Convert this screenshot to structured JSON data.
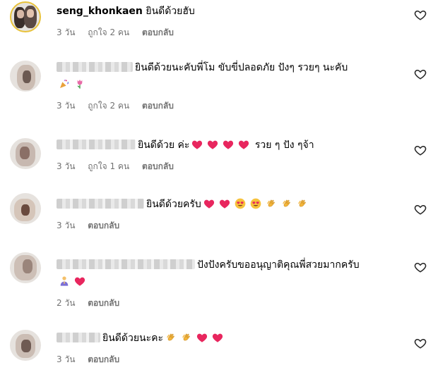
{
  "comments": [
    {
      "username": "seng_khonkaen",
      "text": "ยินดีด้วยฮับ",
      "time": "3 วัน",
      "likes": "ถูกใจ 2 คน",
      "reply": "ตอบกลับ"
    },
    {
      "text": "ยินดีด้วยนะคับพี่โม ขับขี่ปลอดภัย ปังๆ รวยๆ นะคับ",
      "time": "3 วัน",
      "likes": "ถูกใจ 2 คน",
      "reply": "ตอบกลับ"
    },
    {
      "text1": "ยินดีด้วย ค่ะ",
      "text2": "รวย ๆ ปัง ๆจ้า",
      "time": "3 วัน",
      "likes": "ถูกใจ 1 คน",
      "reply": "ตอบกลับ"
    },
    {
      "text": "ยินดีด้วยครับ",
      "time": "3 วัน",
      "reply": "ตอบกลับ"
    },
    {
      "text": "ปังปังครับขออนุญาติคุณพี่สวยมากครับ",
      "time": "2 วัน",
      "reply": "ตอบกลับ"
    },
    {
      "text": "ยินดีด้วยนะคะ",
      "time": "3 วัน",
      "reply": "ตอบกลับ"
    }
  ],
  "icons": {
    "like": "heart-outline-icon",
    "heart_emoji": "red-heart-emoji",
    "eyes_emoji": "heart-eyes-emoji",
    "clap_emoji": "clapping-hands-emoji",
    "party_emoji": "party-popper-emoji",
    "tulip_emoji": "tulip-emoji",
    "pray_emoji": "praying-person-emoji"
  },
  "colors": {
    "meta": "#737373",
    "heart": "#e8265e",
    "story_ring": "#e8c23a"
  }
}
